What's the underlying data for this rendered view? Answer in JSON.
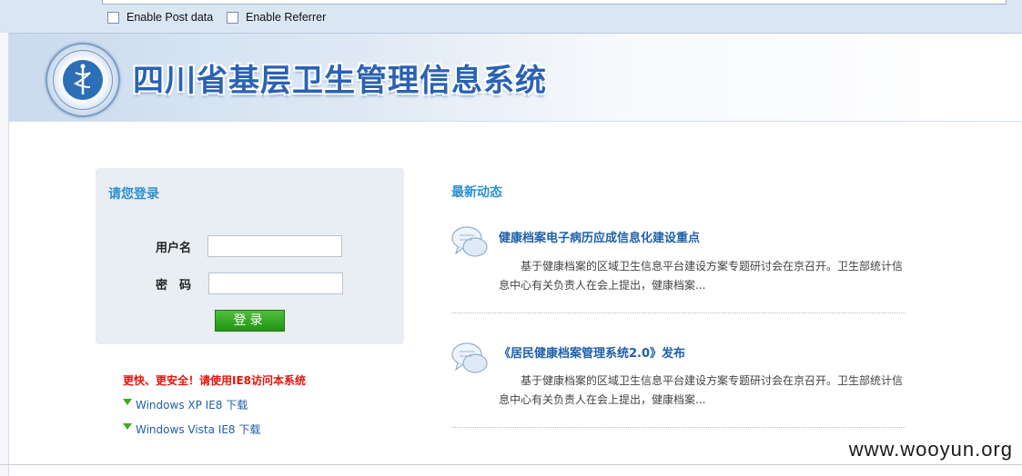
{
  "browser": {
    "post_data_label": "Enable Post data",
    "referrer_label": "Enable Referrer"
  },
  "header": {
    "site_title": "四川省基层卫生管理信息系统"
  },
  "login": {
    "title": "请您登录",
    "username_label": "用户名",
    "password_label": "密　码",
    "submit_label": "登录",
    "notice": "更快、更安全！请使用IE8访问本系统",
    "downloads": [
      "Windows XP IE8 下载",
      "Windows Vista IE8 下载"
    ]
  },
  "news": {
    "heading": "最新动态",
    "items": [
      {
        "title": "健康档案电子病历应成信息化建设重点",
        "body": "基于健康档案的区域卫生信息平台建设方案专题研讨会在京召开。卫生部统计信息中心有关负责人在会上提出，健康档案..."
      },
      {
        "title": "《居民健康档案管理系统2.0》发布",
        "body": "基于健康档案的区域卫生信息平台建设方案专题研讨会在京召开。卫生部统计信息中心有关负责人在会上提出，健康档案..."
      }
    ]
  },
  "watermark": "www.wooyun.org"
}
